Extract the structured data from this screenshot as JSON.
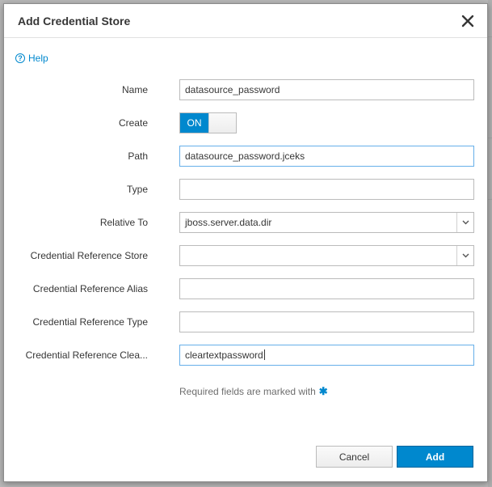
{
  "dialog": {
    "title": "Add Credential Store",
    "help_label": "Help"
  },
  "form": {
    "name": {
      "label": "Name",
      "value": "datasource_password"
    },
    "create": {
      "label": "Create",
      "state": "ON"
    },
    "path": {
      "label": "Path",
      "value": "datasource_password.jceks"
    },
    "type": {
      "label": "Type",
      "value": ""
    },
    "relative_to": {
      "label": "Relative To",
      "value": "jboss.server.data.dir"
    },
    "cred_ref_store": {
      "label": "Credential Reference Store",
      "value": ""
    },
    "cred_ref_alias": {
      "label": "Credential Reference Alias",
      "value": ""
    },
    "cred_ref_type": {
      "label": "Credential Reference Type",
      "value": ""
    },
    "cred_ref_clear": {
      "label": "Credential Reference Clea...",
      "value": "cleartextpassword"
    }
  },
  "required_note": "Required fields are marked with",
  "buttons": {
    "cancel": "Cancel",
    "add": "Add"
  },
  "colors": {
    "accent": "#0088ce",
    "overlay": "#b9b9b9"
  },
  "icons": {
    "close": "close-icon",
    "help": "question-circle-icon",
    "dropdown": "chevron-down-icon",
    "required": "asterisk-icon"
  }
}
